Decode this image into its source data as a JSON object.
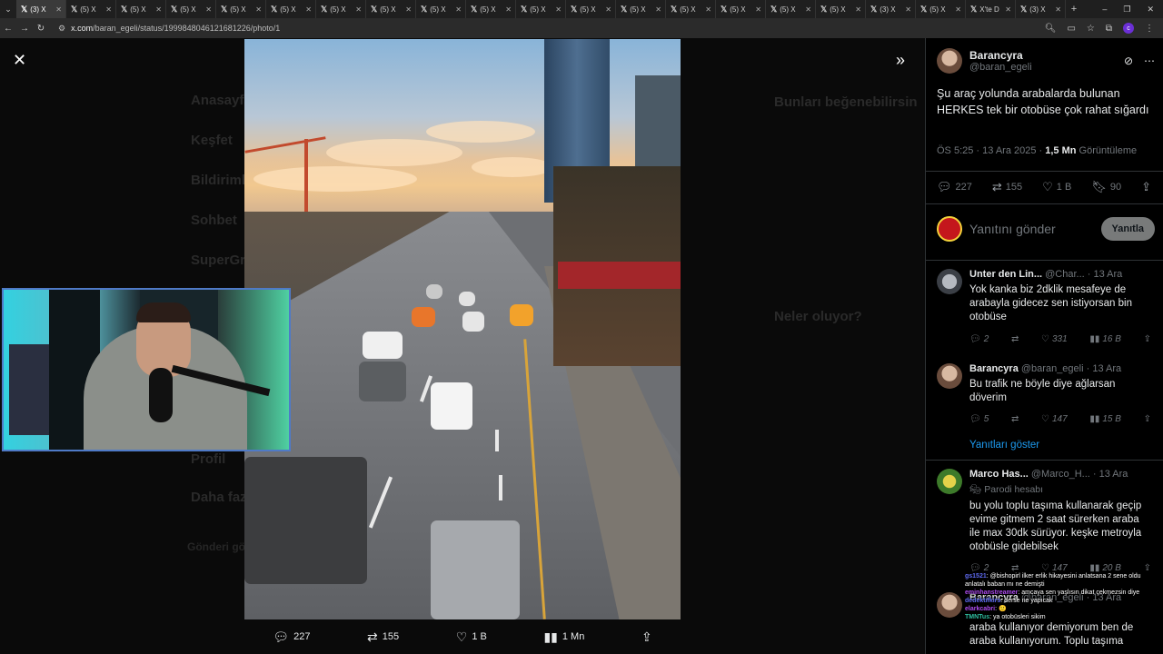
{
  "browser": {
    "active_tab": "(3) X",
    "tabs": [
      "(3) X",
      "(5) X",
      "(5) X",
      "(5) X",
      "(5) X",
      "(5) X",
      "(5) X",
      "(5) X",
      "(5) X",
      "(5) X",
      "(5) X",
      "(5) X",
      "(5) X",
      "(5) X",
      "(5) X",
      "(5) X",
      "(5) X",
      "(3) X",
      "(5) X",
      "X'te D",
      "(3) X"
    ],
    "url_host": "x.com",
    "url_path": "/baran_egeli/status/1999848046121681226/photo/1"
  },
  "background_ghost": {
    "nav": [
      "Anasayfa",
      "Keşfet",
      "Bildirimler",
      "Sohbet",
      "SuperGrok",
      "Profil",
      "Daha fazla"
    ],
    "post_button": "Gönderi gönder",
    "sidebar_title": "Bunları beğenebilirsin",
    "trends_title": "Neler oluyor?"
  },
  "photo_actions": {
    "replies": "227",
    "reposts": "155",
    "likes": "1 B",
    "views": "1 Mn"
  },
  "tweet": {
    "author_name": "Barancyra",
    "author_handle": "@baran_egeli",
    "text": "Şu araç yolunda arabalarda bulunan HERKES tek bir otobüse çok rahat sığardı",
    "time": "ÖS 5:25 · 13 Ara 2025 · ",
    "views_count": "1,5 Mn",
    "views_label": " Görüntüleme",
    "replies": "227",
    "reposts": "155",
    "likes": "1 B",
    "bookmarks": "90"
  },
  "reply_box": {
    "placeholder": "Yanıtını gönder",
    "button": "Yanıtla"
  },
  "replies": [
    {
      "name": "Unter den Lin...",
      "handle": "@Char...",
      "date": "· 13 Ara",
      "text": "Yok kanka biz 2dklik mesafeye de arabayla gidecez sen istiyorsan bin otobüse",
      "replies": "2",
      "likes": "331",
      "views": "16 B"
    },
    {
      "name": "Barancyra",
      "handle": "@baran_egeli",
      "date": "· 13 Ara",
      "text": "Bu trafik ne böyle diye ağlarsan döverim",
      "replies": "5",
      "likes": "147",
      "views": "15 B"
    },
    {
      "name": "Marco Has...",
      "handle": "@Marco_H...",
      "date": "· 13 Ara",
      "badge": "Parodi hesabı",
      "text": "bu yolu toplu taşıma kullanarak geçip evime gitmem 2 saat sürerken araba ile max 30dk sürüyor. keşke metroyla otobüsle gidebilsek",
      "replies": "2",
      "likes": "147",
      "views": "20 B"
    },
    {
      "name": "Barancyra",
      "handle": "@baran_egeli",
      "date": "· 13 Ara",
      "text": "araba kullanıyor demiyorum ben de araba kullanıyorum. Toplu taşıma"
    }
  ],
  "show_replies": "Yanıtları göster",
  "chat": [
    {
      "user": "gs1521",
      "text": ": @bishopirl ilker erlik hikayesini anlatsana 2 sene oldu anlatalı baban mı ne demişti"
    },
    {
      "user": "eminhanstreamer",
      "text": ": amcaya sen yaşlısın dikat çekmezsin diye"
    },
    {
      "user": "dedektifkirs",
      "text": ": derse ne yapıcak"
    },
    {
      "user": "elarkcabri",
      "text": ": 🙂"
    },
    {
      "user": "TMNTus",
      "text": ": ya otobüsleri sikim"
    }
  ],
  "colors": {
    "accent": "#1d9bf0",
    "background": "#000000",
    "muted": "#71767b"
  }
}
